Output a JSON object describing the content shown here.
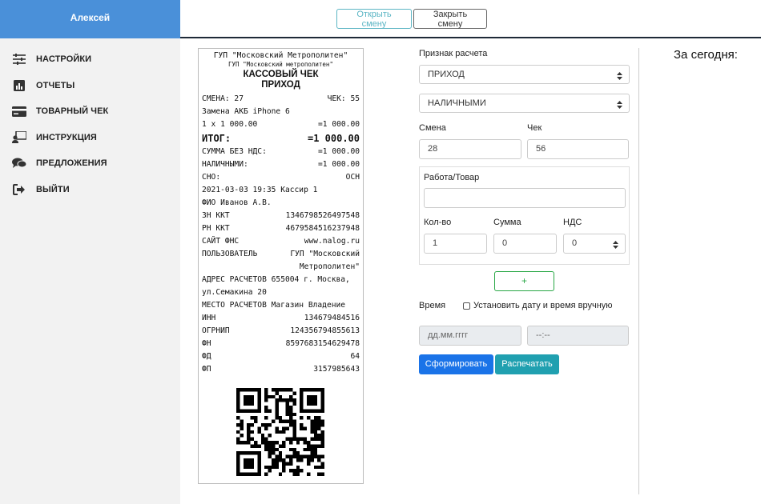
{
  "sidebar": {
    "user": "Алексей",
    "items": [
      {
        "label": "НАСТРОЙКИ",
        "icon": "sliders-icon"
      },
      {
        "label": "ОТЧЕТЫ",
        "icon": "chart-icon"
      },
      {
        "label": "ТОВАРНЫЙ ЧЕК",
        "icon": "card-icon"
      },
      {
        "label": "ИНСТРУКЦИЯ",
        "icon": "user-board-icon"
      },
      {
        "label": "ПРЕДЛОЖЕНИЯ",
        "icon": "comments-icon"
      },
      {
        "label": "ВЫЙТИ",
        "icon": "sign-out-icon"
      }
    ]
  },
  "topbar": {
    "open_shift": "Открыть смену",
    "close_shift": "Закрыть смену"
  },
  "receipt": {
    "org": "ГУП \"Московский Метрополитен\"",
    "org_small": "ГУП \"Московский метрополитен\"",
    "title1": "КАССОВЫЙ ЧЕК",
    "title2": "ПРИХОД",
    "shift_label": "СМЕНА: 27",
    "check_label": "ЧЕК: 55",
    "item_name": "Замена АКБ iPhone 6",
    "item_calc": "1 x 1 000.00",
    "item_sum": "=1 000.00",
    "total_label": "ИТОГ:",
    "total_value": "=1 000.00",
    "no_vat_label": "СУММА БЕЗ НДС:",
    "no_vat_value": "=1 000.00",
    "cash_label": "НАЛИЧНЫМИ:",
    "cash_value": "=1 000.00",
    "sno_label": "СНО:",
    "sno_value": "ОСН",
    "datetime_cashier": "2021-03-03 19:35 Кассир 1",
    "cashier_name": "ФИО Иванов А.В.",
    "zn_label": "ЗН ККТ",
    "zn_value": "1346798526497548",
    "rn_label": "РН ККТ",
    "rn_value": "4679584516237948",
    "site_label": "САЙТ ФНС",
    "site_value": "www.nalog.ru",
    "user_label": "ПОЛЬЗОВАТЕЛЬ",
    "user_value1": "ГУП \"Московский",
    "user_value2": "Метрополитен\"",
    "addr_line1": "АДРЕС РАСЧЕТОВ 655004 г. Москва,",
    "addr_line2": "ул.Семакина 20",
    "place": "МЕСТО РАСЧЕТОВ Магазин Владение",
    "inn_label": "ИНН",
    "inn_value": "134679484516",
    "ogrnip_label": "ОГРНИП",
    "ogrnip_value": "124356794855613",
    "fn_label": "ФН",
    "fn_value": "8597683154629478",
    "fd_label": "ФД",
    "fd_value": "64",
    "fp_label": "ФП",
    "fp_value": "3157985643"
  },
  "form": {
    "calc_sign_label": "Признак расчета",
    "calc_sign_value": "ПРИХОД",
    "payment_value": "НАЛИЧНЫМИ",
    "shift_label": "Смена",
    "shift_value": "28",
    "check_label": "Чек",
    "check_value": "56",
    "item_label": "Работа/Товар",
    "item_value": "",
    "qty_label": "Кол-во",
    "qty_value": "1",
    "sum_label": "Сумма",
    "sum_value": "0",
    "vat_label": "НДС",
    "vat_value": "0",
    "add_button": "+",
    "time_label": "Время",
    "manual_time_label": "Установить дату и время вручную",
    "date_placeholder": "дд.мм.гггг",
    "time_placeholder": "--:--",
    "generate_button": "Сформировать",
    "print_button": "Распечатать"
  },
  "today_title": "За сегодня:",
  "colors": {
    "sidebar_header": "#4a90d9",
    "primary": "#1a73e8",
    "info": "#20a0b0",
    "success": "#28a745"
  }
}
